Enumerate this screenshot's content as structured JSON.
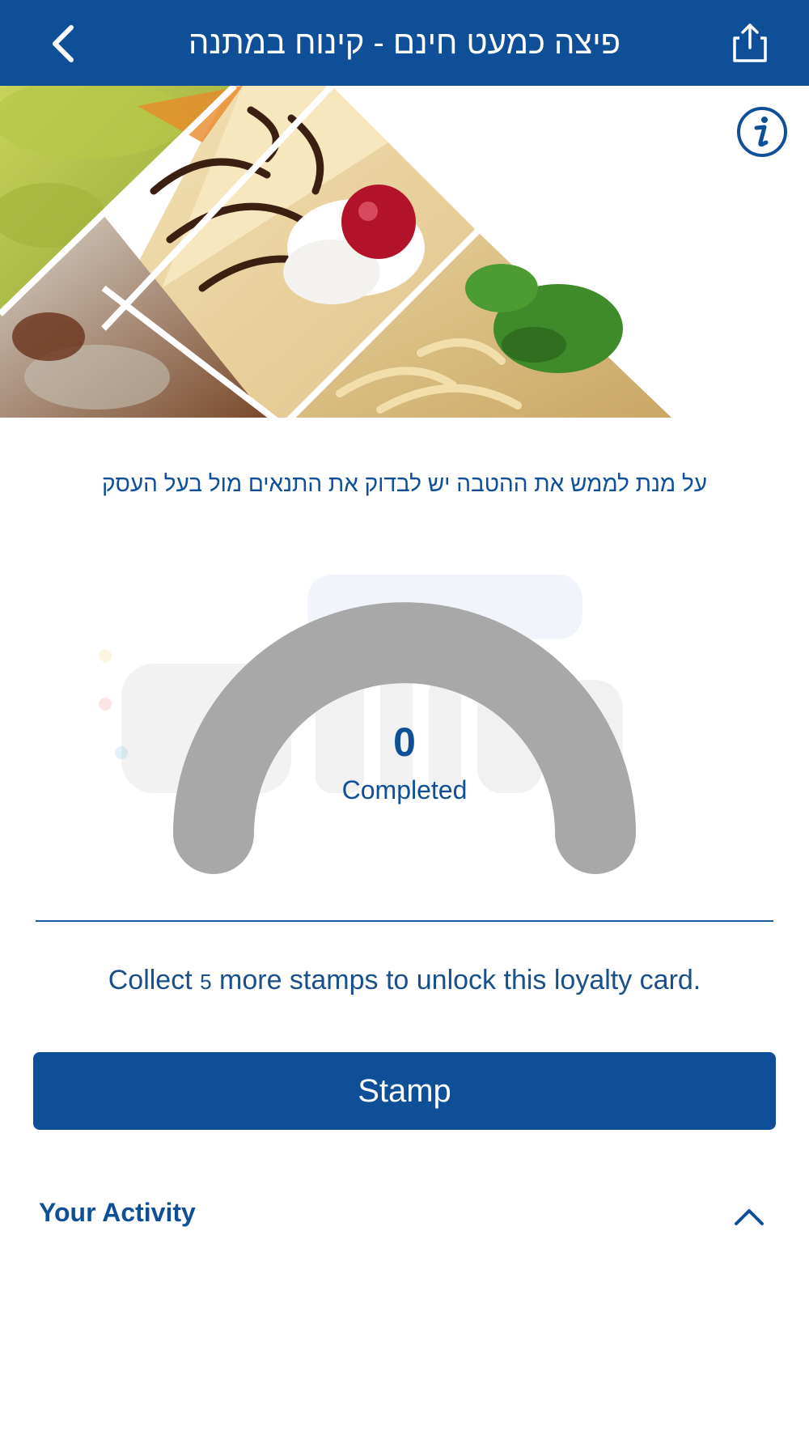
{
  "header": {
    "title": "פיצה כמעט חינם - קינוח במתנה",
    "back_icon": "chevron-left-icon",
    "share_icon": "share-icon",
    "background_color": "#0f4f97"
  },
  "hero": {
    "image_description_icon": "food-collage-image",
    "info_icon": "info-icon"
  },
  "notice_text": "על מנת לממש את ההטבה יש לבדוק את התנאים מול בעל העסק",
  "progress": {
    "count": "0",
    "label": "Completed",
    "fraction_complete": 0,
    "track_color": "#a8a8a8"
  },
  "collect": {
    "prefix": "Collect ",
    "count": "5",
    "suffix": " more stamps to unlock this loyalty card."
  },
  "stamp_button": {
    "label": "Stamp",
    "color": "#0f4f97"
  },
  "activity": {
    "title": "Your Activity",
    "toggle_icon": "chevron-up-icon"
  }
}
